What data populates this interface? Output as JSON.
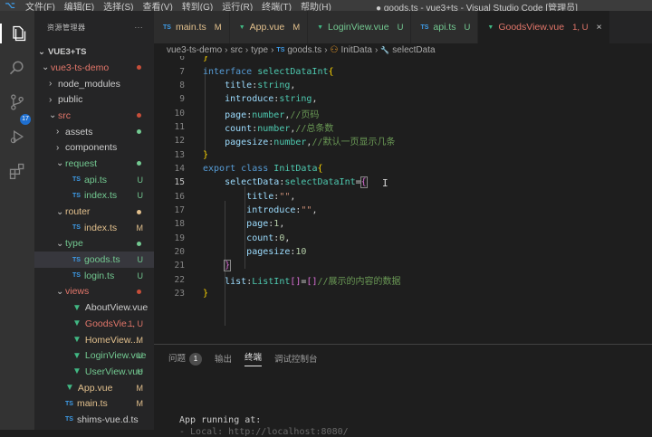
{
  "titlebar": {
    "logo": "⌥",
    "menu": [
      "文件(F)",
      "编辑(E)",
      "选择(S)",
      "查看(V)",
      "转到(G)",
      "运行(R)",
      "终端(T)",
      "帮助(H)"
    ],
    "window_title": "● goods.ts - vue3+ts - Visual Studio Code [管理员]"
  },
  "activity": {
    "scm_badge": "17"
  },
  "sidebar": {
    "header": "资源管理器",
    "more": "···",
    "root": "VUE3+TS",
    "items": [
      {
        "label": "vue3-ts-demo",
        "type": "folder",
        "open": true,
        "indent": 1,
        "color": "red",
        "dot": "#c74e39"
      },
      {
        "label": "node_modules",
        "type": "folder",
        "open": false,
        "indent": 2,
        "color": "normal"
      },
      {
        "label": "public",
        "type": "folder",
        "open": false,
        "indent": 2,
        "color": "normal"
      },
      {
        "label": "src",
        "type": "folder",
        "open": true,
        "indent": 2,
        "color": "red",
        "dot": "#c74e39"
      },
      {
        "label": "assets",
        "type": "folder",
        "open": false,
        "indent": 3,
        "color": "normal",
        "dot": "#73c991"
      },
      {
        "label": "components",
        "type": "folder",
        "open": false,
        "indent": 3,
        "color": "normal"
      },
      {
        "label": "request",
        "type": "folder",
        "open": true,
        "indent": 3,
        "color": "green",
        "dot": "#73c991"
      },
      {
        "label": "api.ts",
        "type": "ts",
        "indent": 4,
        "color": "green",
        "status": "U"
      },
      {
        "label": "index.ts",
        "type": "ts",
        "indent": 4,
        "color": "green",
        "status": "U"
      },
      {
        "label": "router",
        "type": "folder",
        "open": true,
        "indent": 3,
        "color": "yellow",
        "dot": "#e2c08d"
      },
      {
        "label": "index.ts",
        "type": "ts",
        "indent": 4,
        "color": "yellow",
        "status": "M"
      },
      {
        "label": "type",
        "type": "folder",
        "open": true,
        "indent": 3,
        "color": "green",
        "dot": "#73c991"
      },
      {
        "label": "goods.ts",
        "type": "ts",
        "indent": 4,
        "color": "green",
        "status": "U",
        "selected": true
      },
      {
        "label": "login.ts",
        "type": "ts",
        "indent": 4,
        "color": "green",
        "status": "U"
      },
      {
        "label": "views",
        "type": "folder",
        "open": true,
        "indent": 3,
        "color": "red",
        "dot": "#c74e39"
      },
      {
        "label": "AboutView.vue",
        "type": "vue",
        "indent": 4,
        "color": "normal"
      },
      {
        "label": "GoodsVie...",
        "type": "vue",
        "indent": 4,
        "color": "red",
        "status": "1, U"
      },
      {
        "label": "HomeView....",
        "type": "vue",
        "indent": 4,
        "color": "yellow",
        "status": "M"
      },
      {
        "label": "LoginView.vue",
        "type": "vue",
        "indent": 4,
        "color": "green",
        "status": "U"
      },
      {
        "label": "UserView.vue",
        "type": "vue",
        "indent": 4,
        "color": "green",
        "status": "U"
      },
      {
        "label": "App.vue",
        "type": "vue",
        "indent": 3,
        "color": "yellow",
        "status": "M"
      },
      {
        "label": "main.ts",
        "type": "ts",
        "indent": 3,
        "color": "yellow",
        "status": "M"
      },
      {
        "label": "shims-vue.d.ts",
        "type": "ts",
        "indent": 3,
        "color": "normal"
      }
    ]
  },
  "tabs": [
    {
      "icon": "TS",
      "label": "main.ts",
      "status": "M",
      "color": "yellow"
    },
    {
      "icon": "V",
      "label": "App.vue",
      "status": "M",
      "color": "yellow"
    },
    {
      "icon": "V",
      "label": "LoginView.vue",
      "status": "U",
      "color": "green"
    },
    {
      "icon": "TS",
      "label": "api.ts",
      "status": "U",
      "color": "green"
    },
    {
      "icon": "V",
      "label": "GoodsView.vue",
      "status": "1, U",
      "color": "red"
    }
  ],
  "breadcrumb": [
    "vue3-ts-demo",
    "src",
    "type",
    "goods.ts",
    "InitData",
    "selectData"
  ],
  "editor": {
    "line_numbers": [
      "6",
      "7",
      "8",
      "9",
      "10",
      "11",
      "12",
      "13",
      "14",
      "15",
      "16",
      "17",
      "18",
      "19",
      "20",
      "21",
      "22",
      "23"
    ],
    "current_line": "15"
  },
  "panel": {
    "tabs": [
      "问题",
      "输出",
      "终端",
      "调试控制台"
    ],
    "problems_count": "1",
    "active": "终端",
    "terminal_line": "App running at:",
    "terminal_line2": "  - Local:   http://localhost:8080/"
  }
}
